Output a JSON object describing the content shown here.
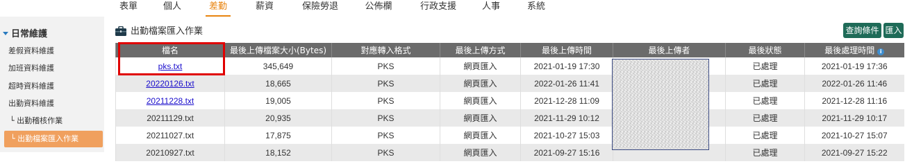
{
  "nav": {
    "tabs": [
      {
        "label": "表單"
      },
      {
        "label": "個人"
      },
      {
        "label": "差勤",
        "active": true
      },
      {
        "label": "薪資"
      },
      {
        "label": "保險勞退"
      },
      {
        "label": "公佈欄"
      },
      {
        "label": "行政支援"
      },
      {
        "label": "人事"
      },
      {
        "label": "系統"
      }
    ],
    "accent_color": "#e8830e"
  },
  "sidebar": {
    "group_label": "日常維護",
    "items": [
      {
        "label": "差假資料維護"
      },
      {
        "label": "加班資料維護"
      },
      {
        "label": "超時資料維護"
      },
      {
        "label": "出勤資料維護"
      },
      {
        "label": "└ 出勤稽核作業"
      },
      {
        "label": "└ 出勤檔案匯入作業",
        "active": true
      }
    ],
    "active_color": "#f0a05e"
  },
  "page": {
    "title": "出勤檔案匯入作業",
    "title_icon": "briefcase-icon",
    "query_button": "查詢條件",
    "import_button": "匯入",
    "button_color": "#1f6b58"
  },
  "table": {
    "headers": [
      "檔名",
      "最後上傳檔案大小(Bytes)",
      "對應轉入格式",
      "最後上傳方式",
      "最後上傳時間",
      "最後上傳者",
      "最後狀態",
      "最後處理時間"
    ],
    "rows": [
      {
        "file": "pks.txt",
        "link": true,
        "size": "345,649",
        "format": "PKS",
        "method": "網頁匯入",
        "upload_time": "2021-01-19 17:30",
        "uploader": "",
        "status": "已處理",
        "processed_time": "2021-01-19 17:36"
      },
      {
        "file": "20220126.txt",
        "link": true,
        "size": "18,665",
        "format": "PKS",
        "method": "網頁匯入",
        "upload_time": "2022-01-26 11:41",
        "uploader": "",
        "status": "已處理",
        "processed_time": "2022-01-26 11:46"
      },
      {
        "file": "20211228.txt",
        "link": true,
        "size": "19,005",
        "format": "PKS",
        "method": "網頁匯入",
        "upload_time": "2021-12-28 11:09",
        "uploader": "",
        "status": "已處理",
        "processed_time": "2021-12-28 11:16"
      },
      {
        "file": "20211129.txt",
        "link": false,
        "size": "20,935",
        "format": "PKS",
        "method": "網頁匯入",
        "upload_time": "2021-11-29 10:12",
        "uploader": "",
        "status": "已處理",
        "processed_time": "2021-11-29 10:17"
      },
      {
        "file": "20211027.txt",
        "link": false,
        "size": "17,875",
        "format": "PKS",
        "method": "網頁匯入",
        "upload_time": "2021-10-27 15:03",
        "uploader": "",
        "status": "已處理",
        "processed_time": "2021-10-27 15:07"
      },
      {
        "file": "20210927.txt",
        "link": false,
        "size": "18,152",
        "format": "PKS",
        "method": "網頁匯入",
        "upload_time": "2021-09-27 15:16",
        "uploader": "",
        "status": "已處理",
        "processed_time": "2021-09-27 15:22"
      }
    ],
    "header_color": "#6b6b6b",
    "highlight_color": "#e00000"
  }
}
